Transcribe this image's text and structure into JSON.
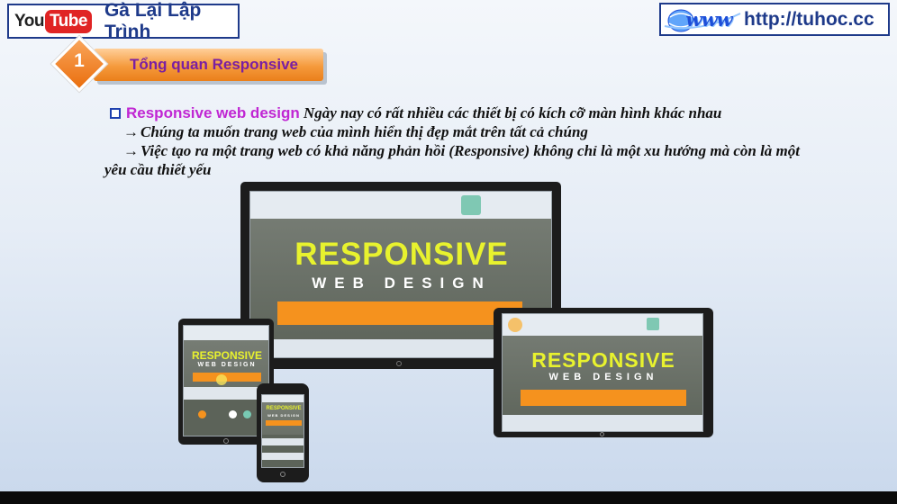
{
  "channel": {
    "logo_you": "You",
    "logo_tube": "Tube",
    "name": "Gà Lại Lập Trình"
  },
  "website": {
    "logo": "www",
    "url": "http://tuhoc.cc"
  },
  "section": {
    "number": "1",
    "title": "Tổng quan Responsive"
  },
  "content": {
    "term": "Responsive web design",
    "intro": "Ngày nay có rất nhiều các thiết bị có kích cỡ màn hình khác nhau",
    "arrow": "→",
    "point1": "Chúng ta muốn trang web của mình hiển thị đẹp mắt trên tất cả chúng",
    "point2_line1": "Việc tạo ra một trang web có khả năng phản hồi (Responsive) không chỉ là một xu hướng mà còn là một",
    "point2_line2": "yêu cầu thiết yếu"
  },
  "illustration": {
    "title": "RESPONSIVE",
    "subtitle": "WEB DESIGN"
  },
  "colors": {
    "heading_bar": "#f59a3c",
    "term": "#c026d3",
    "frame": "#1e3a8a",
    "responsive_text": "#e8f22e"
  }
}
